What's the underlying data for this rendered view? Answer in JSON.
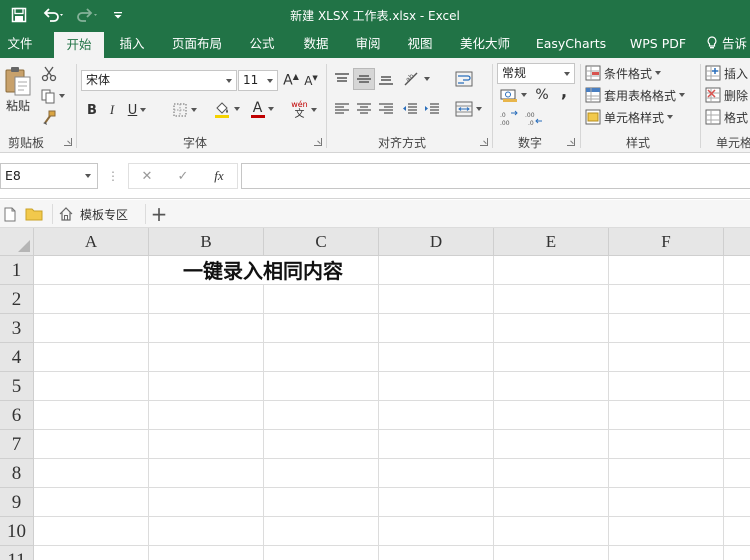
{
  "window": {
    "title": "新建 XLSX 工作表.xlsx - Excel"
  },
  "tabs": [
    {
      "label": "文件"
    },
    {
      "label": "开始"
    },
    {
      "label": "插入"
    },
    {
      "label": "页面布局"
    },
    {
      "label": "公式"
    },
    {
      "label": "数据"
    },
    {
      "label": "审阅"
    },
    {
      "label": "视图"
    },
    {
      "label": "美化大师"
    },
    {
      "label": "EasyCharts"
    },
    {
      "label": "WPS PDF"
    },
    {
      "label": "告诉"
    }
  ],
  "active_tab": "开始",
  "ribbon": {
    "clipboard": {
      "label": "剪贴板",
      "paste_label": "粘贴"
    },
    "font": {
      "label": "字体",
      "font_name": "宋体",
      "font_size": "11",
      "bold": "B",
      "italic": "I",
      "underline": "U",
      "font_color_glyph": "A",
      "phonetic_glyph": "wén"
    },
    "alignment": {
      "label": "对齐方式"
    },
    "number": {
      "label": "数字",
      "format": "常规",
      "percent": "%",
      "comma": ","
    },
    "styles": {
      "label": "样式",
      "conditional": "条件格式",
      "table_format": "套用表格格式",
      "cell_style": "单元格样式"
    },
    "cells": {
      "label": "单元格",
      "insert": "插入",
      "delete": "删除",
      "format": "格式"
    }
  },
  "formula_bar": {
    "name_box": "E8",
    "cancel_glyph": "✕",
    "enter_glyph": "✓",
    "fx_glyph": "fx",
    "value": ""
  },
  "quick_bar": {
    "template_label": "模板专区",
    "add_glyph": "+"
  },
  "sheet": {
    "columns": [
      "A",
      "B",
      "C",
      "D",
      "E",
      "F"
    ],
    "rows": [
      "1",
      "2",
      "3",
      "4",
      "5",
      "6",
      "7",
      "8",
      "9",
      "10",
      "11"
    ],
    "title_cell": "一键录入相同内容",
    "active_cell": "E8"
  },
  "colors": {
    "accent": "#217346",
    "ribbon_bg": "#f3f3f3",
    "header_bg": "#e6e6e6"
  }
}
